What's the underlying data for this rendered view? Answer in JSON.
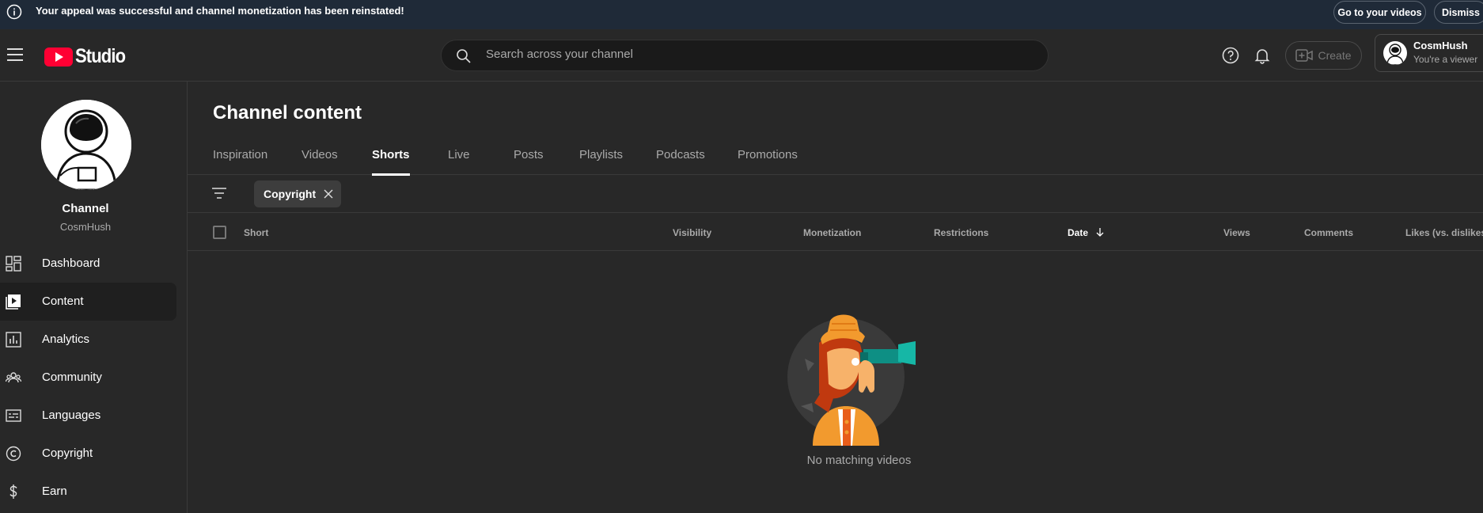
{
  "banner": {
    "message": "Your appeal was successful and channel monetization has been reinstated!",
    "go_label": "Go to your videos",
    "dismiss_label": "Dismiss"
  },
  "header": {
    "logo_text": "Studio",
    "search_placeholder": "Search across your channel",
    "create_label": "Create",
    "account_name": "CosmHush",
    "account_role": "You're a viewer"
  },
  "sidebar": {
    "channel_title": "Channel",
    "channel_handle": "CosmHush",
    "items": [
      {
        "label": "Dashboard",
        "icon": "dashboard-icon"
      },
      {
        "label": "Content",
        "icon": "content-icon",
        "active": true
      },
      {
        "label": "Analytics",
        "icon": "analytics-icon"
      },
      {
        "label": "Community",
        "icon": "community-icon"
      },
      {
        "label": "Languages",
        "icon": "languages-icon"
      },
      {
        "label": "Copyright",
        "icon": "copyright-icon"
      },
      {
        "label": "Earn",
        "icon": "earn-icon"
      }
    ]
  },
  "main": {
    "title": "Channel content",
    "tabs": [
      "Inspiration",
      "Videos",
      "Shorts",
      "Live",
      "Posts",
      "Playlists",
      "Podcasts",
      "Promotions"
    ],
    "active_tab": "Shorts",
    "filter_chip": "Copyright",
    "columns": [
      "Short",
      "Visibility",
      "Monetization",
      "Restrictions",
      "Date",
      "Views",
      "Comments",
      "Likes (vs. dislikes)"
    ],
    "sorted_column": "Date",
    "empty_text": "No matching videos"
  }
}
